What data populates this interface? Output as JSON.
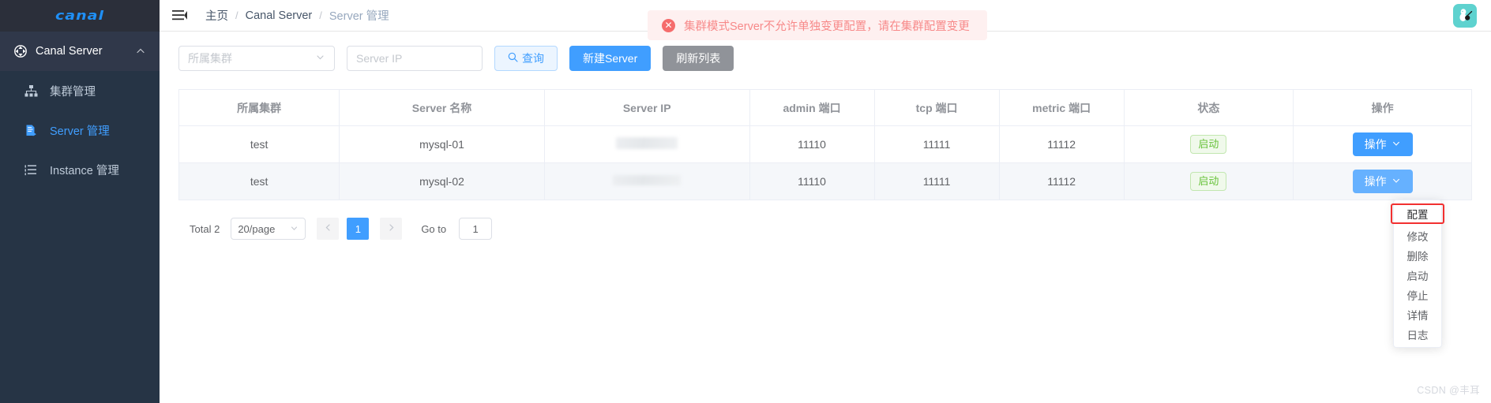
{
  "sidebar": {
    "logo": "canal",
    "group": {
      "label": "Canal Server",
      "icon": "canal-node-icon",
      "chevron": "chevron-up-icon"
    },
    "items": [
      {
        "label": "集群管理",
        "icon": "cluster-icon",
        "active": false
      },
      {
        "label": "Server 管理",
        "icon": "server-doc-icon",
        "active": true
      },
      {
        "label": "Instance 管理",
        "icon": "instance-list-icon",
        "active": false
      }
    ]
  },
  "topbar": {
    "hamburger_icon": "hamburger-icon",
    "breadcrumb": [
      "主页",
      "Canal Server",
      "Server 管理"
    ],
    "separator": "/",
    "avatar_icon": "user-avatar-icon"
  },
  "alert": {
    "icon": "error-circle-icon",
    "message": "集群模式Server不允许单独变更配置，请在集群配置变更",
    "bg_color": "#fef0f0",
    "text_color": "#f78989",
    "icon_color": "#f56c6c",
    "icon_glyph": "✕"
  },
  "filterbar": {
    "cluster_select": {
      "placeholder": "所属集群",
      "value": "",
      "chevron": "chevron-down-icon"
    },
    "server_ip_input": {
      "placeholder": "Server IP",
      "value": ""
    },
    "search_button": {
      "label": "查询",
      "icon": "search-icon"
    },
    "create_button": {
      "label": "新建Server"
    },
    "refresh_button": {
      "label": "刷新列表"
    }
  },
  "table": {
    "columns": [
      "所属集群",
      "Server 名称",
      "Server IP",
      "admin 端口",
      "tcp 端口",
      "metric 端口",
      "状态",
      "操作"
    ],
    "rows": [
      {
        "cluster": "test",
        "name": "mysql-01",
        "ip": "",
        "admin_port": "11110",
        "tcp_port": "11111",
        "metric_port": "11112",
        "status": "启动",
        "action_label": "操作",
        "action_chevron": "chevron-down-icon"
      },
      {
        "cluster": "test",
        "name": "mysql-02",
        "ip": "",
        "admin_port": "11110",
        "tcp_port": "11111",
        "metric_port": "11112",
        "status": "启动",
        "action_label": "操作",
        "action_chevron": "chevron-down-icon"
      }
    ]
  },
  "pagination": {
    "total_label": "Total 2",
    "page_size": "20/page",
    "prev_icon": "chevron-left-icon",
    "next_icon": "chevron-right-icon",
    "current_page": "1",
    "goto_label": "Go to",
    "goto_value": "1"
  },
  "dropdown": {
    "items": [
      {
        "label": "配置",
        "highlighted": true
      },
      {
        "label": "修改",
        "highlighted": false
      },
      {
        "label": "删除",
        "highlighted": false
      },
      {
        "label": "启动",
        "highlighted": false
      },
      {
        "label": "停止",
        "highlighted": false
      },
      {
        "label": "详情",
        "highlighted": false
      },
      {
        "label": "日志",
        "highlighted": false
      }
    ],
    "highlight_color": "#f23030"
  },
  "watermark": "CSDN @丰耳",
  "colors": {
    "sidebar_bg": "#263445",
    "sidebar_logo_bg": "#2b2f3a",
    "accent": "#409eff",
    "status_green": "#67c23a",
    "grey_button": "#909399"
  }
}
